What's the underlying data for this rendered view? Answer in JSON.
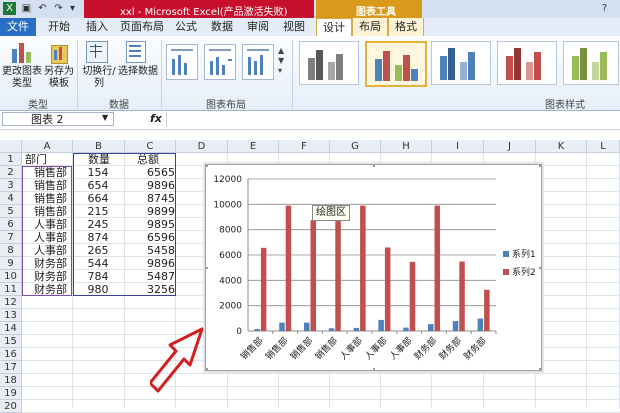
{
  "titlebar": {
    "title": "xxl - Microsoft Excel(产品激活失败)",
    "context_tool": "图表工具",
    "icons": [
      "excel-logo-icon",
      "save-icon",
      "undo-icon",
      "redo-icon",
      "customize-qat-icon"
    ]
  },
  "tabs": [
    "文件",
    "开始",
    "插入",
    "页面布局",
    "公式",
    "数据",
    "审阅",
    "视图",
    "设计",
    "布局",
    "格式"
  ],
  "ribbon": {
    "type_group": {
      "label": "类型",
      "change_type": "更改图表类型",
      "save_template": "另存为模板"
    },
    "data_group": {
      "label": "数据",
      "switch_row_col": "切换行/列",
      "select_data": "选择数据"
    },
    "layout_group": {
      "label": "图表布局"
    },
    "style_group": {
      "label": "图表样式"
    }
  },
  "formula_bar": {
    "name_box": "图表 2",
    "fx": "fx",
    "value": ""
  },
  "columns": [
    "A",
    "B",
    "C",
    "D",
    "E",
    "F",
    "G",
    "H",
    "I",
    "J",
    "K",
    "L"
  ],
  "rows": [
    "1",
    "2",
    "3",
    "4",
    "5",
    "6",
    "7",
    "8",
    "9",
    "10",
    "11",
    "12",
    "13",
    "14",
    "15",
    "16",
    "17",
    "18",
    "19",
    "20"
  ],
  "sheet": {
    "headers": [
      "部门",
      "数量",
      "总额"
    ],
    "data": [
      [
        "销售部",
        "154",
        "6565"
      ],
      [
        "销售部",
        "654",
        "9896"
      ],
      [
        "销售部",
        "664",
        "8745"
      ],
      [
        "销售部",
        "215",
        "9899"
      ],
      [
        "人事部",
        "245",
        "9895"
      ],
      [
        "人事部",
        "874",
        "6596"
      ],
      [
        "人事部",
        "265",
        "5458"
      ],
      [
        "财务部",
        "544",
        "9896"
      ],
      [
        "财务部",
        "784",
        "5487"
      ],
      [
        "财务部",
        "980",
        "3256"
      ]
    ]
  },
  "tooltip": "绘图区",
  "chart_data": {
    "type": "bar",
    "categories": [
      "销售部",
      "销售部",
      "销售部",
      "销售部",
      "人事部",
      "人事部",
      "人事部",
      "财务部",
      "财务部",
      "财务部"
    ],
    "series": [
      {
        "name": "系列1",
        "values": [
          154,
          654,
          664,
          215,
          245,
          874,
          265,
          544,
          784,
          980
        ],
        "color": "#4f81bd"
      },
      {
        "name": "系列2",
        "values": [
          6565,
          9896,
          8745,
          9899,
          9895,
          6596,
          5458,
          9896,
          5487,
          3256
        ],
        "color": "#c0504d"
      }
    ],
    "yticks": [
      "0",
      "2000",
      "4000",
      "6000",
      "8000",
      "10000",
      "12000"
    ],
    "ylim": [
      0,
      12000
    ],
    "grid": true,
    "legend": "right"
  },
  "colors": {
    "accent_file_tab": "#2a6fc4",
    "context_tab": "#d99a1c",
    "selection_border": "#3b3fa0",
    "annotation_arrow": "#d21f1f"
  }
}
